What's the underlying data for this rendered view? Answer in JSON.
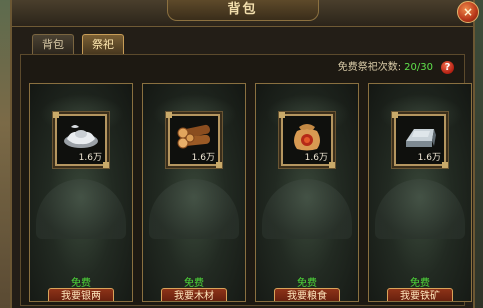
{
  "window": {
    "title": "背包",
    "close_label": "×"
  },
  "tabs": [
    {
      "label": "背包",
      "active": false
    },
    {
      "label": "祭祀",
      "active": true
    }
  ],
  "sacrifice": {
    "free_times_label": "免费祭祀次数:",
    "free_times_count": "20/30",
    "help_label": "?"
  },
  "items": [
    {
      "icon": "silver-ingot-icon",
      "amount": "1.6万",
      "cost_label": "免费",
      "button_label": "我要银两"
    },
    {
      "icon": "wood-logs-icon",
      "amount": "1.6万",
      "cost_label": "免费",
      "button_label": "我要木材"
    },
    {
      "icon": "grain-sack-icon",
      "amount": "1.6万",
      "cost_label": "免费",
      "button_label": "我要粮食"
    },
    {
      "icon": "iron-ore-icon",
      "amount": "1.6万",
      "cost_label": "免费",
      "button_label": "我要铁矿"
    }
  ],
  "colors": {
    "free_text": "#4fdc3a",
    "count_text": "#5fe04b",
    "title_text": "#f3dfae"
  }
}
